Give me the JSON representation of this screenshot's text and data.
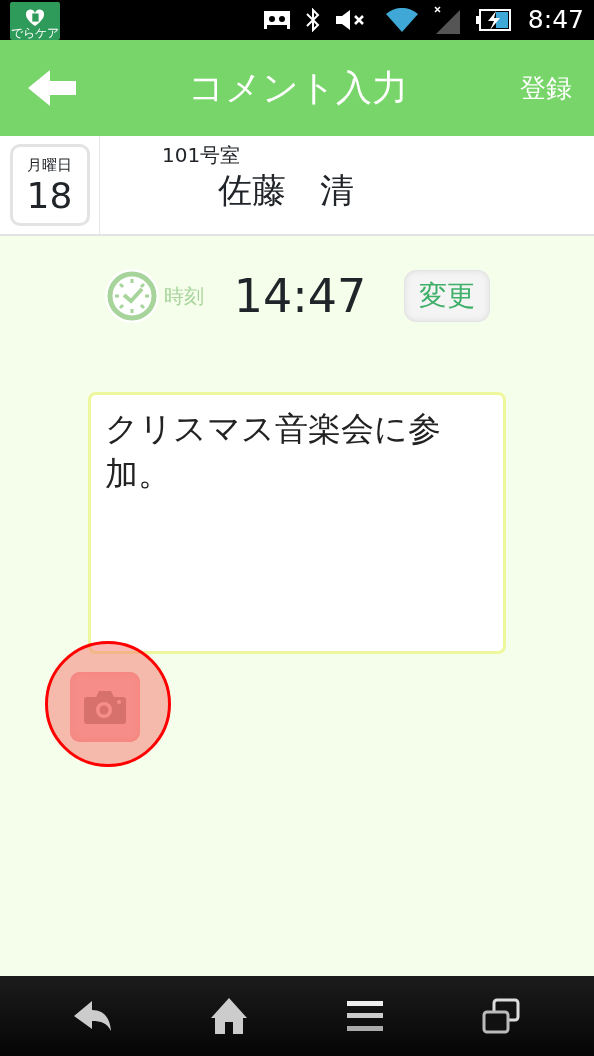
{
  "status_bar": {
    "app_icon_label": "でらケア",
    "time": "8:47"
  },
  "header": {
    "title": "コメント入力",
    "action": "登録"
  },
  "day": {
    "weekday": "月曜日",
    "date": "18"
  },
  "room": "101号室",
  "resident": "佐藤　清",
  "time": {
    "label": "時刻",
    "value": "14:47",
    "button": "変更"
  },
  "comment": {
    "value": "クリスマス音楽会に参加。"
  },
  "camera_button": {
    "highlighted": true
  }
}
